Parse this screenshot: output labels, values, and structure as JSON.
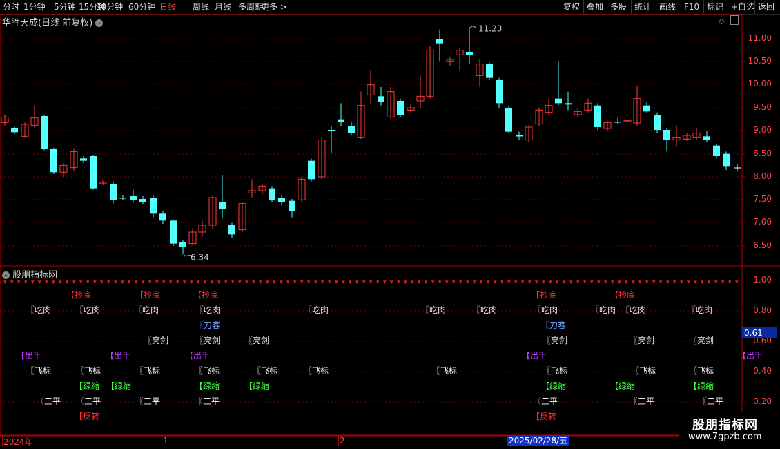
{
  "toolbar": {
    "periods": [
      "分时",
      "1分钟",
      "5分钟",
      "15分钟",
      "30分钟",
      "60分钟",
      "日线",
      "周线",
      "月线",
      "多周期",
      "更多 >"
    ],
    "active_period": "日线",
    "right_buttons": [
      "复权",
      "叠加",
      "多股",
      "统计",
      "画线",
      "F10",
      "标记",
      "+自选",
      "返回"
    ]
  },
  "main_chart": {
    "title": "华胜天成(日线 前复权)",
    "price_labels": [
      "11.00",
      "10.50",
      "10.00",
      "9.50",
      "9.00",
      "8.50",
      "8.00",
      "7.50",
      "7.00",
      "6.50"
    ],
    "high_annotation": "11.23",
    "low_annotation": "6.34",
    "up_color": "#ff3b3b",
    "down_color": "#54ffff"
  },
  "indicator": {
    "title": "股朋指标网",
    "axis_labels": [
      "1.00",
      "0.80",
      "0.60",
      "0.40",
      "0.20"
    ],
    "current_value": "0.61",
    "signals": {
      "chaodi": {
        "text": "【抄底",
        "color": "#ff3030"
      },
      "chirou": {
        "text": "〖吃肉",
        "color": "#ffd0d0"
      },
      "daoke": {
        "text": "〖刀客",
        "color": "#6fa0ff"
      },
      "liangjian": {
        "text": "〖亮剑",
        "color": "#e8e8e8"
      },
      "chushou": {
        "text": "【出手",
        "color": "#c040ff"
      },
      "feibiao": {
        "text": "〖飞标",
        "color": "#ffffff"
      },
      "lvsuo": {
        "text": "【绿缩",
        "color": "#40ff40"
      },
      "sanping": {
        "text": "〖三平",
        "color": "#ffffff"
      },
      "fanzhuan": {
        "text": "【反转",
        "color": "#ff3030"
      }
    }
  },
  "x_axis": {
    "labels": [
      "2024年",
      "1",
      "2"
    ],
    "cursor_date": "2025/02/28/五"
  },
  "watermark": {
    "title": "股朋指标网",
    "url": "www.7gpzb.com"
  }
}
